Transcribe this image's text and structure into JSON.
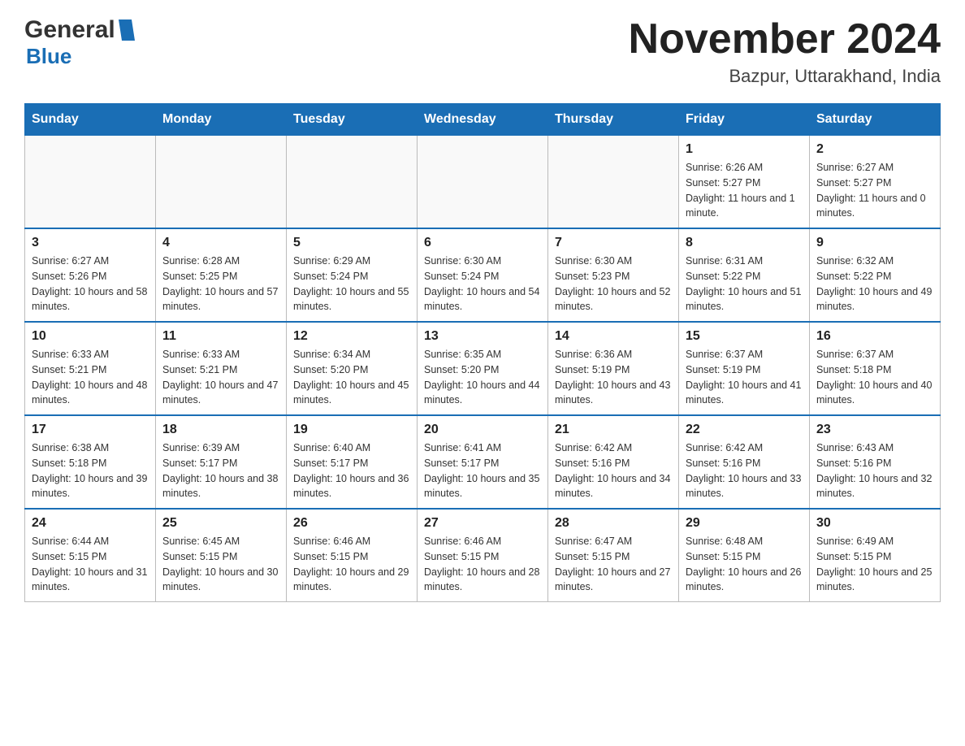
{
  "header": {
    "logo": {
      "general": "General",
      "blue": "Blue"
    },
    "month_title": "November 2024",
    "location": "Bazpur, Uttarakhand, India"
  },
  "calendar": {
    "days_of_week": [
      "Sunday",
      "Monday",
      "Tuesday",
      "Wednesday",
      "Thursday",
      "Friday",
      "Saturday"
    ],
    "weeks": [
      [
        {
          "day": "",
          "info": ""
        },
        {
          "day": "",
          "info": ""
        },
        {
          "day": "",
          "info": ""
        },
        {
          "day": "",
          "info": ""
        },
        {
          "day": "",
          "info": ""
        },
        {
          "day": "1",
          "info": "Sunrise: 6:26 AM\nSunset: 5:27 PM\nDaylight: 11 hours and 1 minute."
        },
        {
          "day": "2",
          "info": "Sunrise: 6:27 AM\nSunset: 5:27 PM\nDaylight: 11 hours and 0 minutes."
        }
      ],
      [
        {
          "day": "3",
          "info": "Sunrise: 6:27 AM\nSunset: 5:26 PM\nDaylight: 10 hours and 58 minutes."
        },
        {
          "day": "4",
          "info": "Sunrise: 6:28 AM\nSunset: 5:25 PM\nDaylight: 10 hours and 57 minutes."
        },
        {
          "day": "5",
          "info": "Sunrise: 6:29 AM\nSunset: 5:24 PM\nDaylight: 10 hours and 55 minutes."
        },
        {
          "day": "6",
          "info": "Sunrise: 6:30 AM\nSunset: 5:24 PM\nDaylight: 10 hours and 54 minutes."
        },
        {
          "day": "7",
          "info": "Sunrise: 6:30 AM\nSunset: 5:23 PM\nDaylight: 10 hours and 52 minutes."
        },
        {
          "day": "8",
          "info": "Sunrise: 6:31 AM\nSunset: 5:22 PM\nDaylight: 10 hours and 51 minutes."
        },
        {
          "day": "9",
          "info": "Sunrise: 6:32 AM\nSunset: 5:22 PM\nDaylight: 10 hours and 49 minutes."
        }
      ],
      [
        {
          "day": "10",
          "info": "Sunrise: 6:33 AM\nSunset: 5:21 PM\nDaylight: 10 hours and 48 minutes."
        },
        {
          "day": "11",
          "info": "Sunrise: 6:33 AM\nSunset: 5:21 PM\nDaylight: 10 hours and 47 minutes."
        },
        {
          "day": "12",
          "info": "Sunrise: 6:34 AM\nSunset: 5:20 PM\nDaylight: 10 hours and 45 minutes."
        },
        {
          "day": "13",
          "info": "Sunrise: 6:35 AM\nSunset: 5:20 PM\nDaylight: 10 hours and 44 minutes."
        },
        {
          "day": "14",
          "info": "Sunrise: 6:36 AM\nSunset: 5:19 PM\nDaylight: 10 hours and 43 minutes."
        },
        {
          "day": "15",
          "info": "Sunrise: 6:37 AM\nSunset: 5:19 PM\nDaylight: 10 hours and 41 minutes."
        },
        {
          "day": "16",
          "info": "Sunrise: 6:37 AM\nSunset: 5:18 PM\nDaylight: 10 hours and 40 minutes."
        }
      ],
      [
        {
          "day": "17",
          "info": "Sunrise: 6:38 AM\nSunset: 5:18 PM\nDaylight: 10 hours and 39 minutes."
        },
        {
          "day": "18",
          "info": "Sunrise: 6:39 AM\nSunset: 5:17 PM\nDaylight: 10 hours and 38 minutes."
        },
        {
          "day": "19",
          "info": "Sunrise: 6:40 AM\nSunset: 5:17 PM\nDaylight: 10 hours and 36 minutes."
        },
        {
          "day": "20",
          "info": "Sunrise: 6:41 AM\nSunset: 5:17 PM\nDaylight: 10 hours and 35 minutes."
        },
        {
          "day": "21",
          "info": "Sunrise: 6:42 AM\nSunset: 5:16 PM\nDaylight: 10 hours and 34 minutes."
        },
        {
          "day": "22",
          "info": "Sunrise: 6:42 AM\nSunset: 5:16 PM\nDaylight: 10 hours and 33 minutes."
        },
        {
          "day": "23",
          "info": "Sunrise: 6:43 AM\nSunset: 5:16 PM\nDaylight: 10 hours and 32 minutes."
        }
      ],
      [
        {
          "day": "24",
          "info": "Sunrise: 6:44 AM\nSunset: 5:15 PM\nDaylight: 10 hours and 31 minutes."
        },
        {
          "day": "25",
          "info": "Sunrise: 6:45 AM\nSunset: 5:15 PM\nDaylight: 10 hours and 30 minutes."
        },
        {
          "day": "26",
          "info": "Sunrise: 6:46 AM\nSunset: 5:15 PM\nDaylight: 10 hours and 29 minutes."
        },
        {
          "day": "27",
          "info": "Sunrise: 6:46 AM\nSunset: 5:15 PM\nDaylight: 10 hours and 28 minutes."
        },
        {
          "day": "28",
          "info": "Sunrise: 6:47 AM\nSunset: 5:15 PM\nDaylight: 10 hours and 27 minutes."
        },
        {
          "day": "29",
          "info": "Sunrise: 6:48 AM\nSunset: 5:15 PM\nDaylight: 10 hours and 26 minutes."
        },
        {
          "day": "30",
          "info": "Sunrise: 6:49 AM\nSunset: 5:15 PM\nDaylight: 10 hours and 25 minutes."
        }
      ]
    ]
  }
}
